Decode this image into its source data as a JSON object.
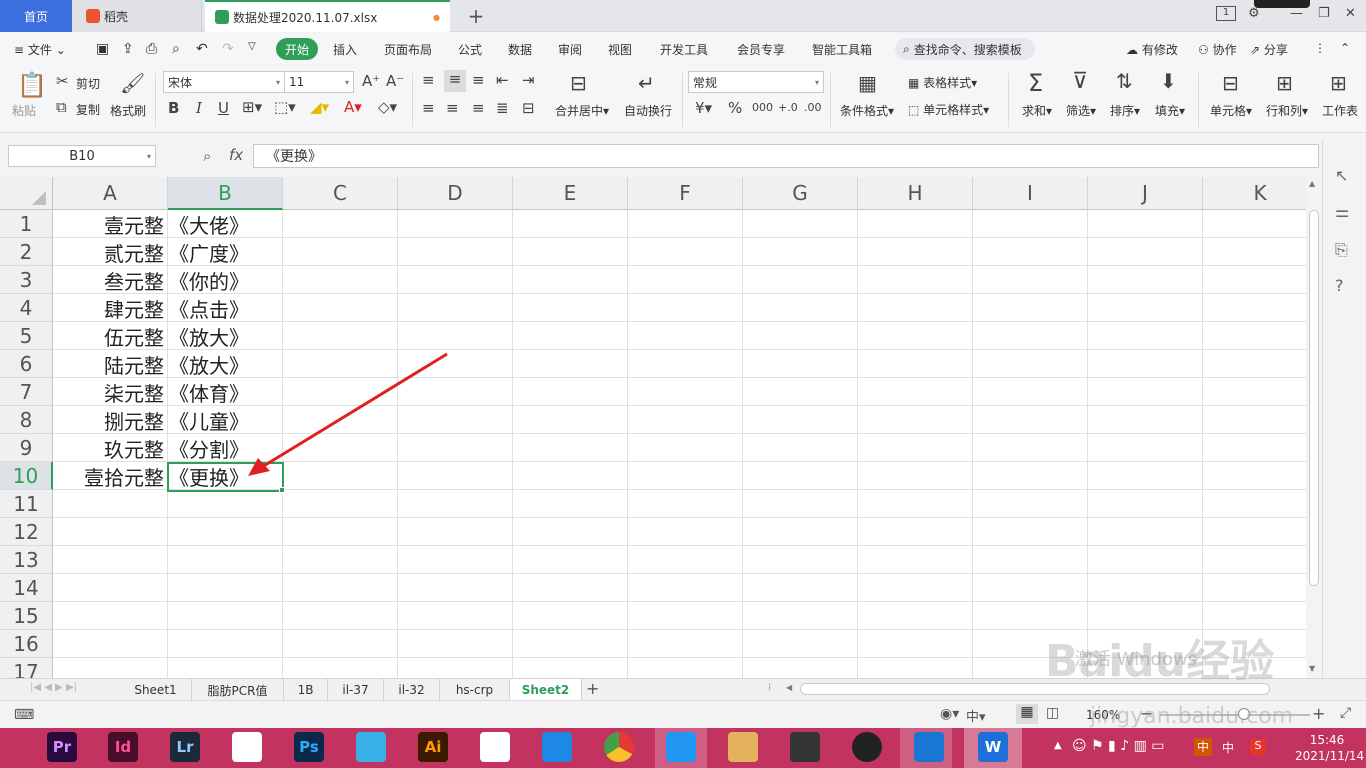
{
  "tabs": {
    "home": "首页",
    "docer": "稻壳",
    "file": "数据处理2020.11.07.xlsx",
    "dot": "●",
    "add": "+"
  },
  "menu": {
    "file": "文件",
    "start": "开始",
    "items": [
      "插入",
      "页面布局",
      "公式",
      "数据",
      "审阅",
      "视图",
      "开发工具",
      "会员专享",
      "智能工具箱"
    ],
    "search": "查找命令、搜索模板",
    "modify": "有修改",
    "collab": "协作",
    "share": "分享"
  },
  "ribbon": {
    "paste": "粘贴",
    "cut": "剪切",
    "copy": "复制",
    "format_painter": "格式刷",
    "font": "宋体",
    "size": "11",
    "number_format": "常规",
    "merge": "合并居中",
    "wrap": "自动换行",
    "cond_format": "条件格式",
    "table_style": "表格样式",
    "cell_style": "单元格样式",
    "sum": "求和",
    "filter": "筛选",
    "sort": "排序",
    "fill": "填充",
    "cell": "单元格",
    "rowcol": "行和列",
    "sheet": "工作表",
    "bold": "B",
    "italic": "I",
    "underline": "U",
    "percent": "%",
    "thousand": "000",
    "currency": "¥",
    "inc_dec": "+.0",
    "dec_dec": ".00"
  },
  "formula": {
    "namebox": "B10",
    "fx": "fx",
    "value": "《更换》"
  },
  "columns": [
    "A",
    "B",
    "C",
    "D",
    "E",
    "F",
    "G",
    "H",
    "I",
    "J",
    "K"
  ],
  "rows": [
    "1",
    "2",
    "3",
    "4",
    "5",
    "6",
    "7",
    "8",
    "9",
    "10",
    "11",
    "12",
    "13",
    "14",
    "15",
    "16",
    "17"
  ],
  "cells_a": [
    "壹元整",
    "贰元整",
    "叁元整",
    "肆元整",
    "伍元整",
    "陆元整",
    "柒元整",
    "捌元整",
    "玖元整",
    "壹拾元整"
  ],
  "cells_b": [
    "《大佬》",
    "《广度》",
    "《你的》",
    "《点击》",
    "《放大》",
    "《放大》",
    "《体育》",
    "《儿童》",
    "《分割》",
    "《更换》"
  ],
  "sheets": [
    "Sheet1",
    "脂肪PCR值",
    "1B",
    "il-37",
    "il-32",
    "hs-crp",
    "Sheet2"
  ],
  "active_sheet": "Sheet2",
  "status": {
    "zoom": "160%"
  },
  "taskbar": {
    "apps": [
      "Pr",
      "Id",
      "Lr",
      "",
      "Ps",
      "",
      "Ai",
      "",
      "",
      "",
      "",
      "",
      "",
      "",
      ""
    ],
    "time": "15:46",
    "date": "2021/11/14",
    "ime": "中"
  },
  "watermark": {
    "main": "Baidu经验",
    "activate": "激活 Windows",
    "url": "jingyan.baidu.com"
  },
  "colors": {
    "accent": "#2e9e59",
    "home_tab": "#3d6ee0",
    "taskbar": "#c2335f",
    "arrow": "#e02020"
  }
}
